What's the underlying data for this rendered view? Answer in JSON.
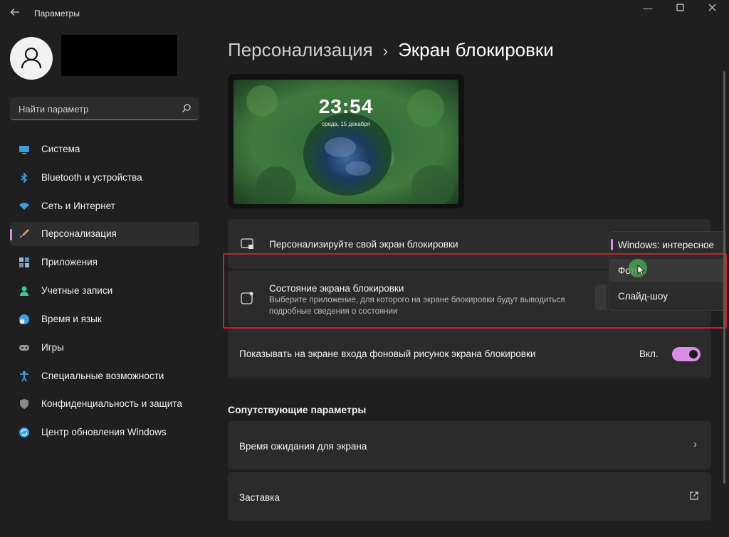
{
  "window": {
    "title": "Параметры",
    "back_icon": "arrow-left-icon",
    "controls": [
      "minimize-icon",
      "maximize-icon",
      "close-icon"
    ]
  },
  "colors": {
    "accent": "#d98de6",
    "background": "#1f1f1f",
    "card": "#2b2b2b",
    "highlight_border": "#d21f1f"
  },
  "search": {
    "placeholder": "Найти параметр",
    "icon": "search-icon"
  },
  "sidebar": {
    "items": [
      {
        "label": "Система",
        "icon": "display-icon",
        "selected": false
      },
      {
        "label": "Bluetooth и устройства",
        "icon": "bluetooth-icon",
        "selected": false
      },
      {
        "label": "Сеть и Интернет",
        "icon": "wifi-icon",
        "selected": false
      },
      {
        "label": "Персонализация",
        "icon": "brush-icon",
        "selected": true
      },
      {
        "label": "Приложения",
        "icon": "apps-icon",
        "selected": false
      },
      {
        "label": "Учетные записи",
        "icon": "person-icon",
        "selected": false
      },
      {
        "label": "Время и язык",
        "icon": "globe-clock-icon",
        "selected": false
      },
      {
        "label": "Игры",
        "icon": "gamepad-icon",
        "selected": false
      },
      {
        "label": "Специальные возможности",
        "icon": "accessibility-icon",
        "selected": false
      },
      {
        "label": "Конфиденциальность и защита",
        "icon": "shield-icon",
        "selected": false
      },
      {
        "label": "Центр обновления Windows",
        "icon": "update-icon",
        "selected": false
      }
    ]
  },
  "breadcrumb": {
    "parent": "Персонализация",
    "separator": "›",
    "current": "Экран блокировки"
  },
  "preview": {
    "time": "23:54",
    "date": "среда, 15 декабря"
  },
  "settings": {
    "personalize": {
      "title": "Персонализируйте свой экран блокировки",
      "icon": "lock-screen-icon"
    },
    "status": {
      "title": "Состояние экрана блокировки",
      "description": "Выберите приложение, для которого на экране блокировки будут выводиться подробные сведения о состоянии",
      "icon": "status-icon"
    },
    "signin_background": {
      "title": "Показывать на экране входа фоновый рисунок экрана блокировки",
      "toggle_label": "Вкл.",
      "toggle_on": true
    }
  },
  "dropdown": {
    "options": [
      {
        "label": "Windows: интересное",
        "selected": true
      },
      {
        "label": "Фото",
        "selected": false,
        "hover": true
      },
      {
        "label": "Слайд-шоу",
        "selected": false
      }
    ]
  },
  "related": {
    "heading": "Сопутствующие параметры",
    "items": [
      {
        "label": "Время ожидания для экрана",
        "icon": "chevron-right-icon"
      },
      {
        "label": "Заставка",
        "icon": "open-external-icon"
      }
    ]
  }
}
